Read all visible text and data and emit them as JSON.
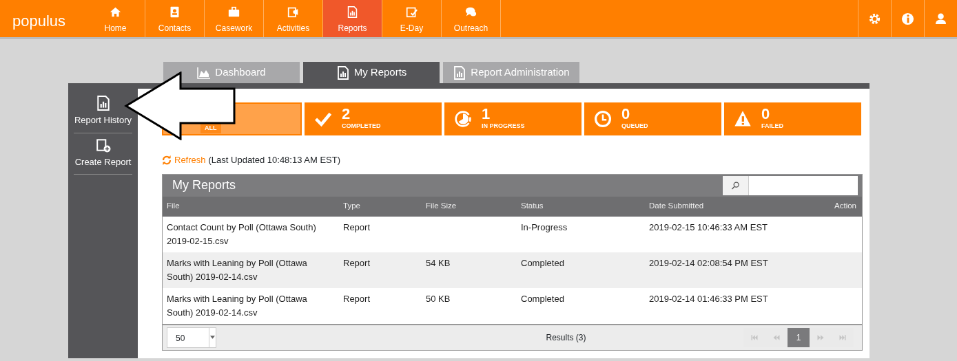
{
  "brand": "populus",
  "nav": [
    {
      "label": "Home",
      "kind": "home",
      "selected": false
    },
    {
      "label": "Contacts",
      "kind": "contacts",
      "selected": false
    },
    {
      "label": "Casework",
      "kind": "case",
      "selected": false
    },
    {
      "label": "Activities",
      "kind": "activities",
      "selected": false
    },
    {
      "label": "Reports",
      "kind": "report",
      "selected": true
    },
    {
      "label": "E-Day",
      "kind": "eday",
      "selected": false
    },
    {
      "label": "Outreach",
      "kind": "chat",
      "selected": false
    }
  ],
  "nav_right": [
    {
      "kind": "settings"
    },
    {
      "kind": "info"
    },
    {
      "kind": "user"
    }
  ],
  "tabs": [
    {
      "label": "Dashboard",
      "kind": "chart",
      "selected": false
    },
    {
      "label": "My Reports",
      "kind": "report",
      "selected": true
    },
    {
      "label": "Report Administration",
      "kind": "report",
      "selected": false
    }
  ],
  "sidebar": [
    {
      "label": "Report History",
      "kind": "report"
    },
    {
      "label": "Create Report",
      "kind": "create"
    }
  ],
  "tiles": [
    {
      "label": "ALL",
      "kind": "all",
      "selected": true
    },
    {
      "count": "2",
      "label": "COMPLETED",
      "kind": "check",
      "selected": false
    },
    {
      "count": "1",
      "label": "IN PROGRESS",
      "kind": "progress",
      "selected": false
    },
    {
      "count": "0",
      "label": "QUEUED",
      "kind": "clock",
      "selected": false
    },
    {
      "count": "0",
      "label": "FAILED",
      "kind": "warning",
      "selected": false
    }
  ],
  "refresh": {
    "link": "Refresh",
    "note": "(Last Updated 10:48:13 AM EST)"
  },
  "table": {
    "title": "My Reports",
    "columns": [
      "File",
      "Type",
      "File Size",
      "Status",
      "Date Submitted",
      "Action"
    ],
    "rows": [
      {
        "cells": [
          "Contact Count by Poll (Ottawa South) 2019-02-15.csv",
          "Report",
          "",
          "In-Progress",
          "2019-02-15 10:46:33 AM EST",
          ""
        ]
      },
      {
        "cells": [
          "Marks with Leaning by Poll (Ottawa South) 2019-02-14.csv",
          "Report",
          "54 KB",
          "Completed",
          "2019-02-14 02:08:54 PM EST",
          ""
        ]
      },
      {
        "cells": [
          "Marks with Leaning by Poll (Ottawa South) 2019-02-14.csv",
          "Report",
          "50 KB",
          "Completed",
          "2019-02-14 01:46:33 PM EST",
          ""
        ]
      }
    ],
    "page_size": "50",
    "results": "Results (3)",
    "pager": [
      {
        "kind": "first",
        "disabled": true
      },
      {
        "kind": "prev",
        "disabled": true
      },
      {
        "kind": "page",
        "label": "1",
        "selected": true
      },
      {
        "kind": "next",
        "disabled": true
      },
      {
        "kind": "last",
        "disabled": true
      }
    ]
  }
}
